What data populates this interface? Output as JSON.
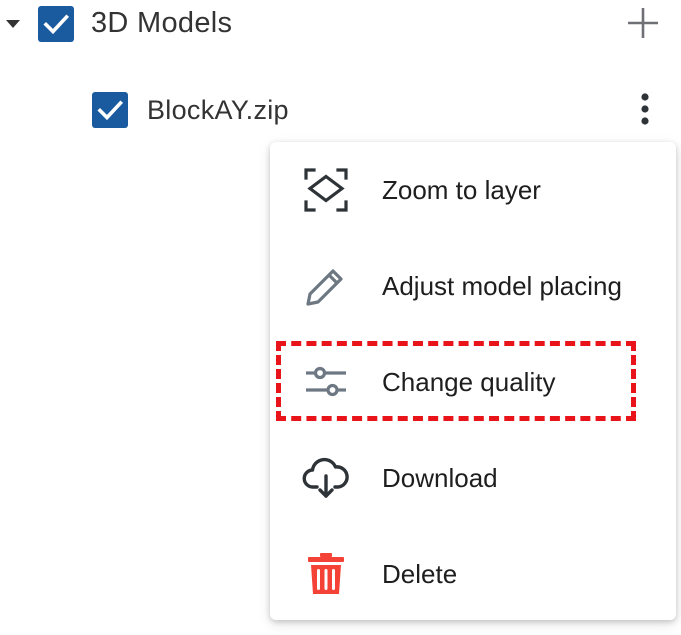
{
  "layer_tree": {
    "group": {
      "label": "3D Models",
      "checked": true,
      "expanded": true,
      "add_icon": "plus-icon",
      "caret_icon": "caret-down-icon"
    },
    "layers": [
      {
        "label": "BlockAY.zip",
        "checked": true,
        "more_icon": "more-vertical-icon"
      }
    ]
  },
  "context_menu": {
    "items": [
      {
        "label": "Zoom to layer",
        "icon": "zoom-to-layer-icon"
      },
      {
        "label": "Adjust model placing",
        "icon": "pencil-icon"
      },
      {
        "label": "Change quality",
        "icon": "sliders-icon",
        "highlighted": true
      },
      {
        "label": "Download",
        "icon": "cloud-download-icon"
      },
      {
        "label": "Delete",
        "icon": "trash-icon"
      }
    ]
  },
  "colors": {
    "checkbox": "#1a5a9f",
    "text": "#333333",
    "menu_text": "#1e1e1e",
    "icon_dark": "#2e3338",
    "icon_gray": "#6e7883",
    "delete_red": "#f44336",
    "highlight_border": "#e8141a"
  }
}
